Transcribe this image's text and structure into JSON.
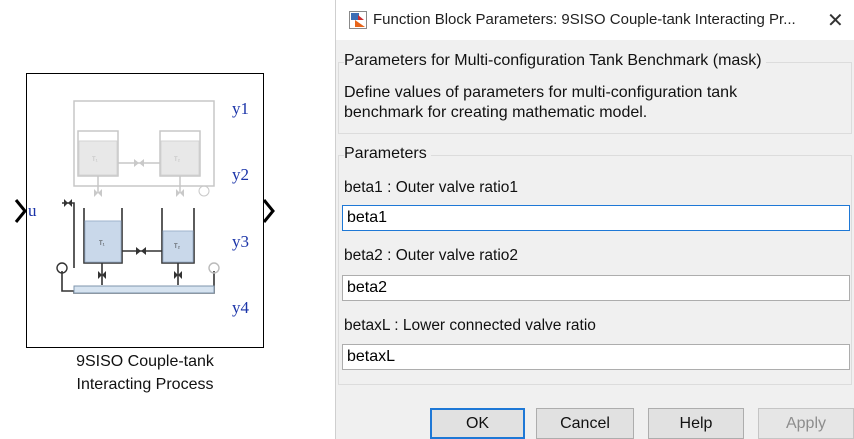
{
  "block": {
    "input_port": "u",
    "output_ports": [
      "y1",
      "y2",
      "y3",
      "y4"
    ],
    "caption_line1": "9SISO Couple-tank",
    "caption_line2": "Interacting Process",
    "schematic_labels": [
      "T₁",
      "T₂",
      "T₁",
      "T₂"
    ]
  },
  "dialog": {
    "title": "Function Block Parameters: 9SISO Couple-tank Interacting Pr...",
    "mask_group_title": "Parameters for Multi-configuration Tank Benchmark (mask)",
    "description_line1": "Define values of parameters for multi-configuration tank",
    "description_line2": "benchmark for creating mathematic model.",
    "parameters_group_title": "Parameters",
    "parameters": [
      {
        "label": "beta1 : Outer valve ratio1",
        "value": "beta1"
      },
      {
        "label": "beta2 : Outer valve ratio2",
        "value": "beta2"
      },
      {
        "label": "betaxL : Lower connected valve ratio",
        "value": "betaxL"
      }
    ],
    "buttons": {
      "ok": "OK",
      "cancel": "Cancel",
      "help": "Help",
      "apply": "Apply"
    }
  },
  "colors": {
    "port_label": "#1a33a8",
    "focus_border": "#1e78d6",
    "dialog_bg": "#f0f0f0"
  }
}
